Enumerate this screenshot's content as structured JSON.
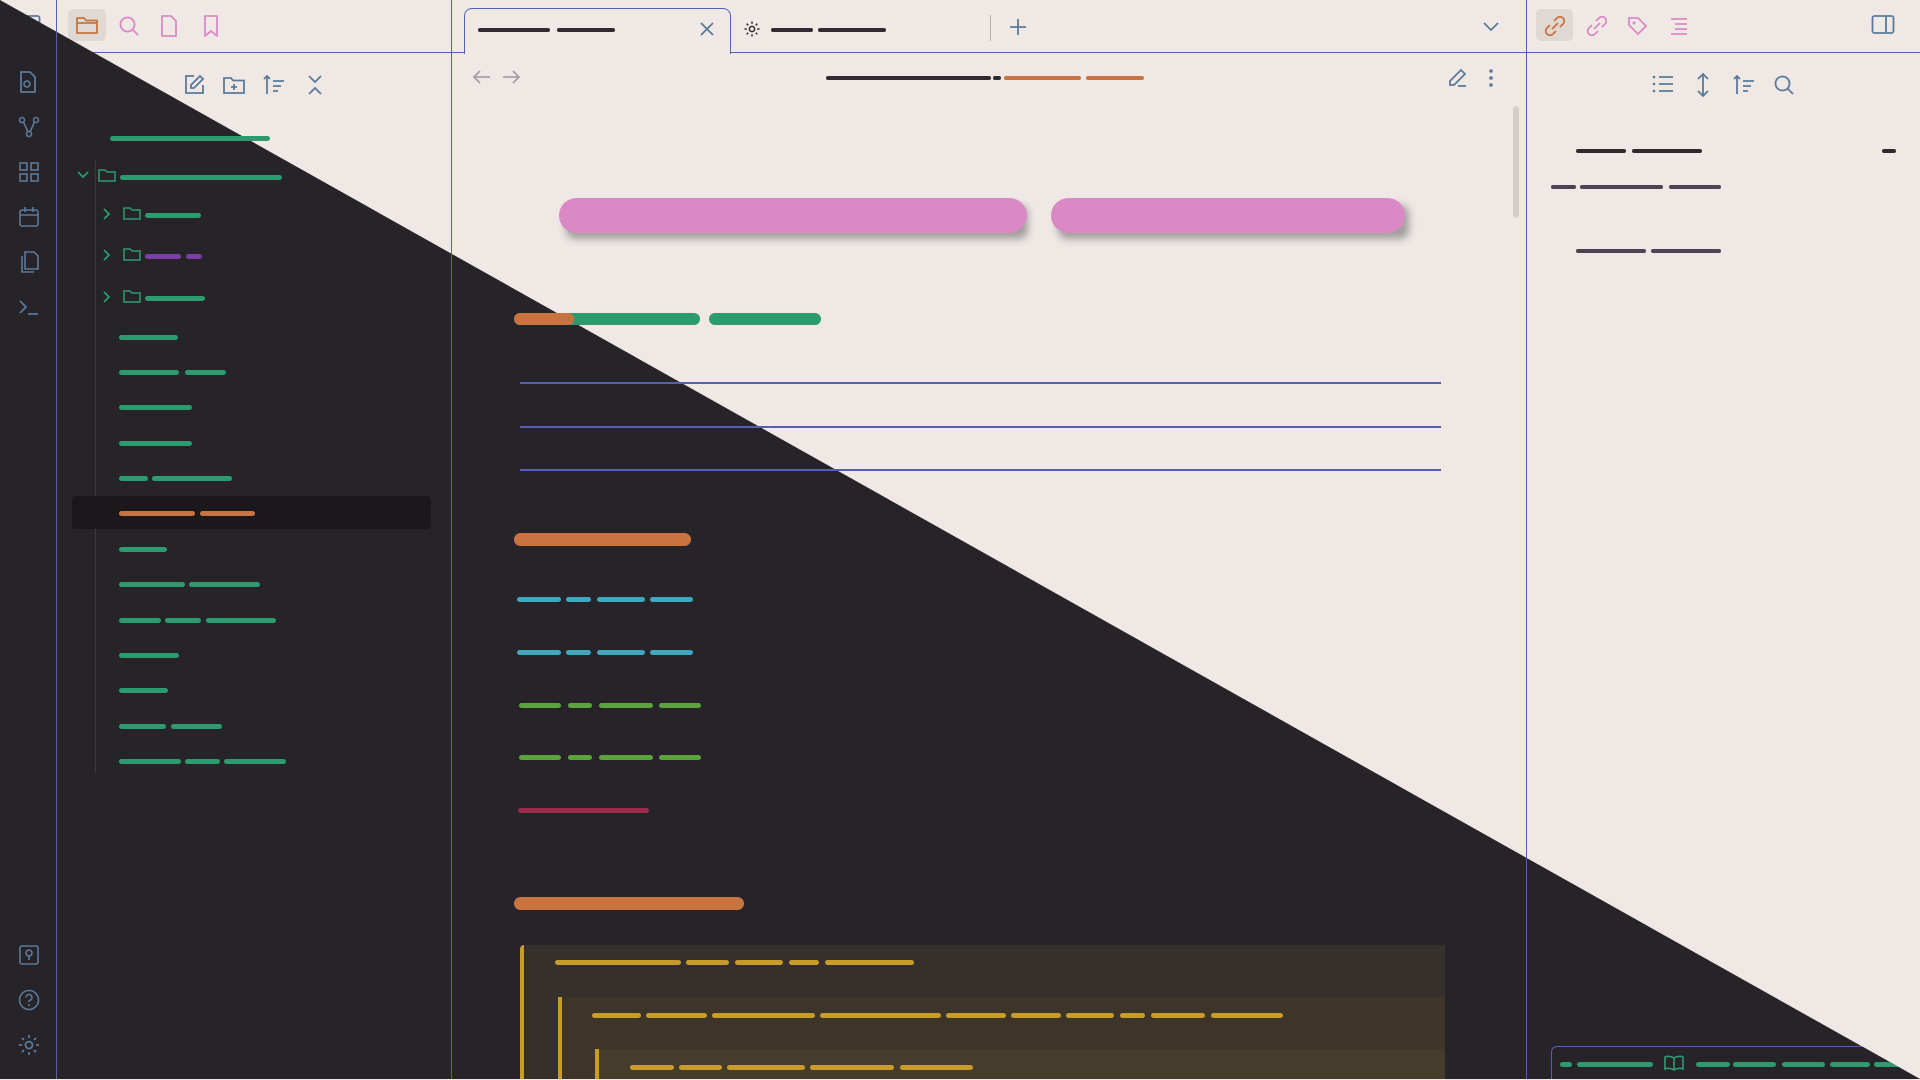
{
  "colors": {
    "light_bg": "#efe8e5",
    "dark_bg": "#262329",
    "accent_green": "#2e9a70",
    "accent_orange": "#c97440",
    "accent_purple": "#7a3fa5",
    "accent_pink": "#d98ac4",
    "rule_blue": "#5361b3",
    "code_teal": "#3fa7bf",
    "code_green": "#5ba43d",
    "code_red": "#9c2b4b",
    "callout_bg": "#35302b",
    "callout_border": "#c99b2c",
    "selected_row": "#1b181b"
  },
  "ribbon": {
    "icons": [
      "sidebar-toggle-icon",
      "quick-switcher-icon",
      "graph-view-icon",
      "canvas-icon",
      "daily-note-icon",
      "templates-icon",
      "command-palette-icon",
      "vault-icon",
      "help-icon",
      "settings-icon"
    ]
  },
  "sidebar_left": {
    "tabs": [
      "files-icon",
      "search-icon",
      "file-icon",
      "bookmark-icon"
    ],
    "toolbar": [
      "new-note-icon",
      "new-folder-icon",
      "sort-icon",
      "collapse-all-icon"
    ]
  },
  "tabs": {
    "items": [
      "active-note-tab",
      "settings-tab"
    ],
    "controls": [
      "new-tab-icon",
      "tab-list-icon"
    ]
  },
  "sidebar_right": {
    "tabs": [
      "backlinks-icon",
      "outgoing-links-icon",
      "tags-icon",
      "outline-icon"
    ],
    "toolbar": [
      "list-icon",
      "expand-icon",
      "sort-icon",
      "search-icon"
    ]
  },
  "status_bar": {
    "icons": [
      "reading-mode-icon"
    ]
  }
}
